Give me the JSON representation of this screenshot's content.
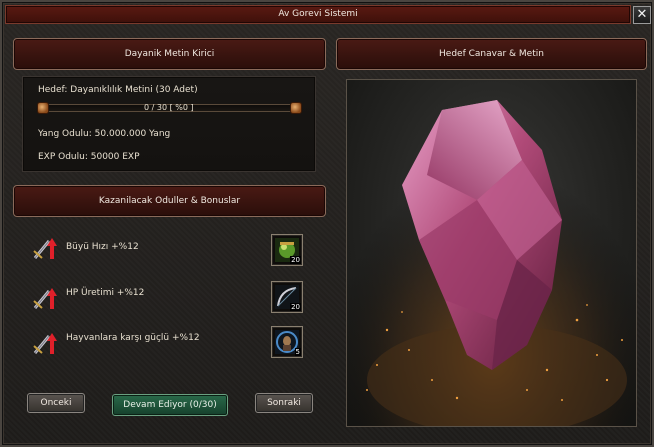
{
  "window": {
    "title": "Av Gorevi Sistemi",
    "close_label": "✕"
  },
  "left_header": {
    "title": "Dayanik Metin Kirici"
  },
  "target": {
    "label": "Hedef: Dayanıklılık Metini (30 Adet)",
    "progress_text": "0 / 30  [ %0 ]",
    "progress_fraction": 0,
    "yang_reward": "Yang Odulu: 50.000.000 Yang",
    "exp_reward": "EXP Odulu: 50000 EXP"
  },
  "rewards_header": {
    "title": "Kazanilacak Oduller & Bonuslar"
  },
  "bonuses": [
    {
      "label": "Büyü Hızı +%12",
      "icon": "sword-arrow-up-icon",
      "item_icon": "green-potion-icon",
      "item_qty": "20"
    },
    {
      "label": "HP Üretimi +%12",
      "icon": "sword-arrow-up-icon",
      "item_icon": "bow-icon",
      "item_qty": "20"
    },
    {
      "label": "Hayvanlara karşı güçlü +%12",
      "icon": "sword-arrow-up-icon",
      "item_icon": "portrait-scroll-icon",
      "item_qty": "5"
    }
  ],
  "buttons": {
    "prev": "Onceki",
    "status": "Devam Ediyor (0/30)",
    "next": "Sonraki"
  },
  "right_header": {
    "title": "Hedef Canavar & Metin"
  },
  "colors": {
    "title_bar": "#4a140e",
    "header": "#3a120e",
    "status_button": "#1e5034",
    "stone": "#b04a78"
  }
}
